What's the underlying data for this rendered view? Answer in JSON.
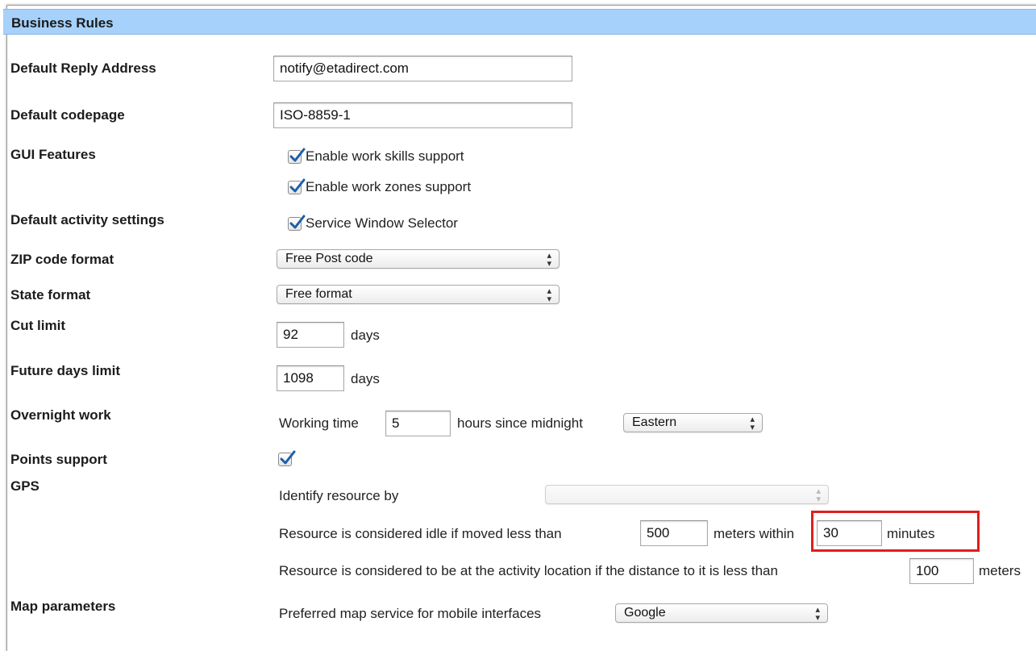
{
  "section": {
    "title": "Business Rules"
  },
  "rows": {
    "reply_address": {
      "label": "Default Reply Address",
      "value": "notify@etadirect.com"
    },
    "codepage": {
      "label": "Default codepage",
      "value": "ISO-8859-1"
    },
    "gui_features": {
      "label": "GUI Features",
      "option_skills": "Enable work skills support",
      "option_zones": "Enable work zones support",
      "skills_checked": true,
      "zones_checked": true
    },
    "activity_settings": {
      "label": "Default activity settings",
      "option_window": "Service Window Selector",
      "window_checked": true
    },
    "zip_format": {
      "label": "ZIP code format",
      "selected": "Free Post code"
    },
    "state_format": {
      "label": "State format",
      "selected": "Free format"
    },
    "cut_limit": {
      "label": "Cut limit",
      "value": "92",
      "unit": "days"
    },
    "future_days": {
      "label": "Future days limit",
      "value": "1098",
      "unit": "days"
    },
    "overnight": {
      "label": "Overnight work",
      "prefix": "Working time",
      "value": "5",
      "suffix": "hours since midnight",
      "timezone": "Eastern"
    },
    "points": {
      "label": "Points support",
      "checked": true
    },
    "gps": {
      "label": "GPS",
      "identify_label": "Identify resource by",
      "identify_value": "",
      "idle_prefix": "Resource is considered idle if moved less than",
      "idle_distance": "500",
      "idle_middle": "meters within",
      "idle_minutes": "30",
      "idle_suffix": "minutes",
      "location_prefix": "Resource is considered to be at the activity location if the distance to it is less than",
      "location_distance": "100",
      "location_suffix": "meters"
    },
    "map": {
      "label": "Map parameters",
      "prefix": "Preferred map service for mobile interfaces",
      "selected": "Google"
    }
  },
  "colors": {
    "header_bg": "#a6d1fb",
    "highlight": "#e01e1e",
    "check": "#1d5fa8"
  }
}
